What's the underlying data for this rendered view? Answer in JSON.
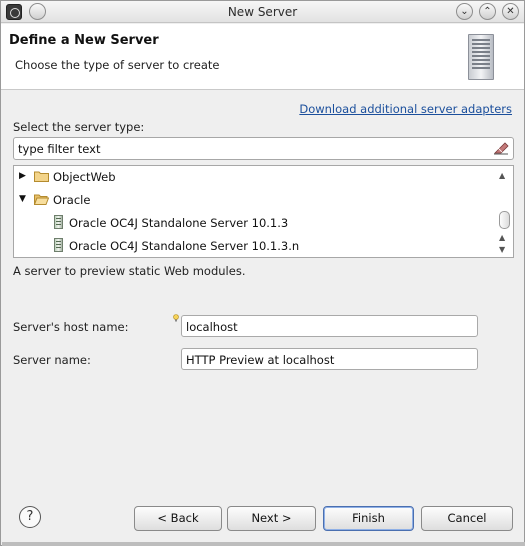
{
  "window": {
    "title": "New Server"
  },
  "banner": {
    "title": "Define a New Server",
    "subtitle": "Choose the type of server to create"
  },
  "download_link": "Download additional server adapters",
  "server_type_label": "Select the server type:",
  "filter": {
    "value": "type filter text"
  },
  "tree": {
    "items": [
      {
        "label": "ObjectWeb",
        "expanded": false,
        "kind": "folder"
      },
      {
        "label": "Oracle",
        "expanded": true,
        "kind": "folder"
      },
      {
        "label": "Oracle OC4J Standalone Server 10.1.3",
        "kind": "server"
      },
      {
        "label": "Oracle OC4J Standalone Server 10.1.3.n",
        "kind": "server"
      }
    ]
  },
  "description": "A server to preview static Web modules.",
  "host": {
    "label": "Server's host name:",
    "value": "localhost"
  },
  "server_name": {
    "label": "Server name:",
    "value": "HTTP Preview at localhost"
  },
  "buttons": {
    "back": "< Back",
    "next": "Next >",
    "finish": "Finish",
    "cancel": "Cancel",
    "help": "?"
  },
  "titlebar_buttons": {
    "minimize": "⌄",
    "maximize": "⌃",
    "close": "✕"
  },
  "colors": {
    "link": "#1b4f9c",
    "banner_bg": "#ffffff",
    "dialog_bg": "#efefef"
  }
}
